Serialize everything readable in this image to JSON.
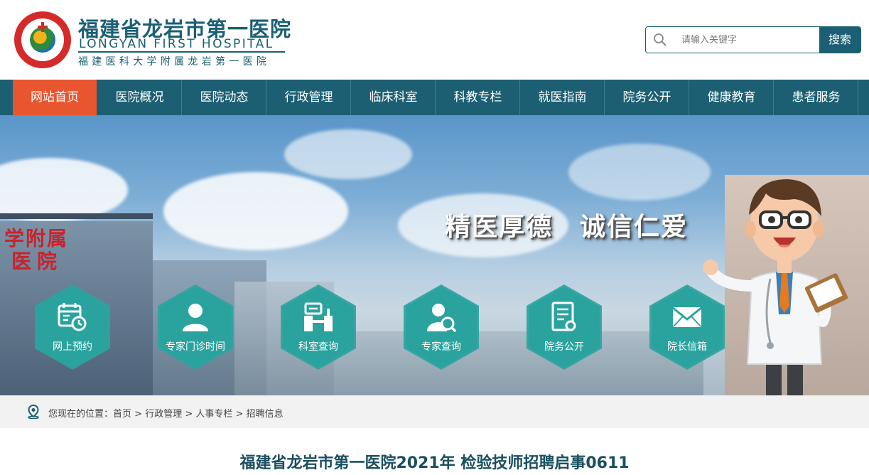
{
  "header": {
    "logo_cn": "福建省龙岩市第一医院",
    "logo_en": "LONGYAN FIRST HOSPITAL",
    "logo_sub": "福建医科大学附属龙岩第一医院",
    "logo_emblem_icon": "hospital-emblem-icon"
  },
  "search": {
    "placeholder": "请输入关键字",
    "button_label": "搜索",
    "icon": "search-icon"
  },
  "nav": {
    "items": [
      {
        "label": "网站首页",
        "active": true
      },
      {
        "label": "医院概况"
      },
      {
        "label": "医院动态"
      },
      {
        "label": "行政管理"
      },
      {
        "label": "临床科室"
      },
      {
        "label": "科教专栏"
      },
      {
        "label": "就医指南"
      },
      {
        "label": "院务公开"
      },
      {
        "label": "健康教育"
      },
      {
        "label": "患者服务"
      }
    ]
  },
  "banner": {
    "slogan": "精医厚德　诚信仁爱",
    "building_sign_1": "学附属",
    "building_sign_2": "医院",
    "quick_links": [
      {
        "label": "网上预约",
        "icon": "calendar-clock-icon"
      },
      {
        "label": "专家门诊时间",
        "icon": "person-icon"
      },
      {
        "label": "科室查询",
        "icon": "department-icon"
      },
      {
        "label": "专家查询",
        "icon": "person-search-icon"
      },
      {
        "label": "院务公开",
        "icon": "document-icon"
      },
      {
        "label": "院长信箱",
        "icon": "mail-icon"
      }
    ]
  },
  "breadcrumb": {
    "prefix": "您现在的位置：",
    "items": [
      "首页",
      "行政管理",
      "人事专栏",
      "招聘信息"
    ],
    "separator": " > ",
    "icon": "location-pin-icon"
  },
  "article": {
    "title": "福建省龙岩市第一医院2021年 检验技师招聘启事0611"
  },
  "colors": {
    "primary": "#1c5f73",
    "active": "#e8562f",
    "teal": "#2aa39f"
  }
}
